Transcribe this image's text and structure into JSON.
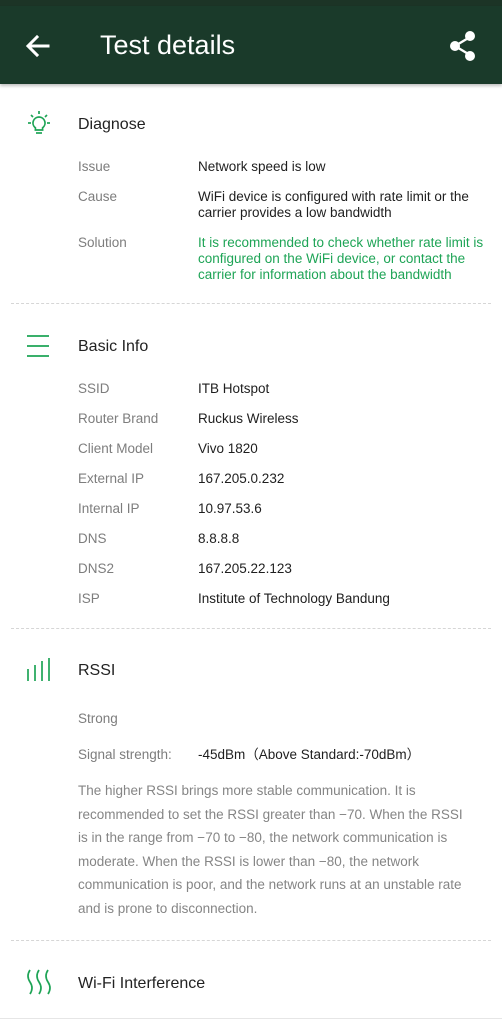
{
  "app_bar": {
    "title": "Test details",
    "back_icon": "arrow-left-icon",
    "share_icon": "share-icon"
  },
  "colors": {
    "app_bar_bg": "#1a3a2a",
    "accent_green": "#1ea456"
  },
  "diagnose": {
    "title": "Diagnose",
    "icon": "lightbulb-icon",
    "rows": [
      {
        "label": "Issue",
        "value": "Network speed is low"
      },
      {
        "label": "Cause",
        "value": "WiFi device is configured with rate limit or the carrier provides a low bandwidth"
      },
      {
        "label": "Solution",
        "value": "It is recommended to check whether rate limit is configured on the WiFi device, or contact the carrier for information about the bandwidth"
      }
    ]
  },
  "basic_info": {
    "title": "Basic Info",
    "icon": "list-icon",
    "rows": [
      {
        "label": "SSID",
        "value": "ITB Hotspot"
      },
      {
        "label": "Router Brand",
        "value": "Ruckus Wireless"
      },
      {
        "label": "Client Model",
        "value": "Vivo 1820"
      },
      {
        "label": "External IP",
        "value": "167.205.0.232"
      },
      {
        "label": "Internal IP",
        "value": "10.97.53.6"
      },
      {
        "label": "DNS",
        "value": "8.8.8.8"
      },
      {
        "label": "DNS2",
        "value": "167.205.22.123"
      },
      {
        "label": "ISP",
        "value": "Institute of Technology Bandung"
      }
    ]
  },
  "rssi": {
    "title": "RSSI",
    "icon": "signal-bars-icon",
    "status": "Strong",
    "signal_label": "Signal strength:",
    "signal_value": "-45dBm（Above Standard:-70dBm）",
    "description": "The higher RSSI brings more stable communication. It is recommended to set the RSSI greater than −70. When the RSSI is in the range from −70 to −80, the network communication is moderate. When the RSSI is lower than −80, the network communication is poor, and the network runs at an unstable rate and is prone to disconnection."
  },
  "wifi_interference": {
    "title": "Wi-Fi Interference",
    "icon": "wave-lines-icon"
  }
}
